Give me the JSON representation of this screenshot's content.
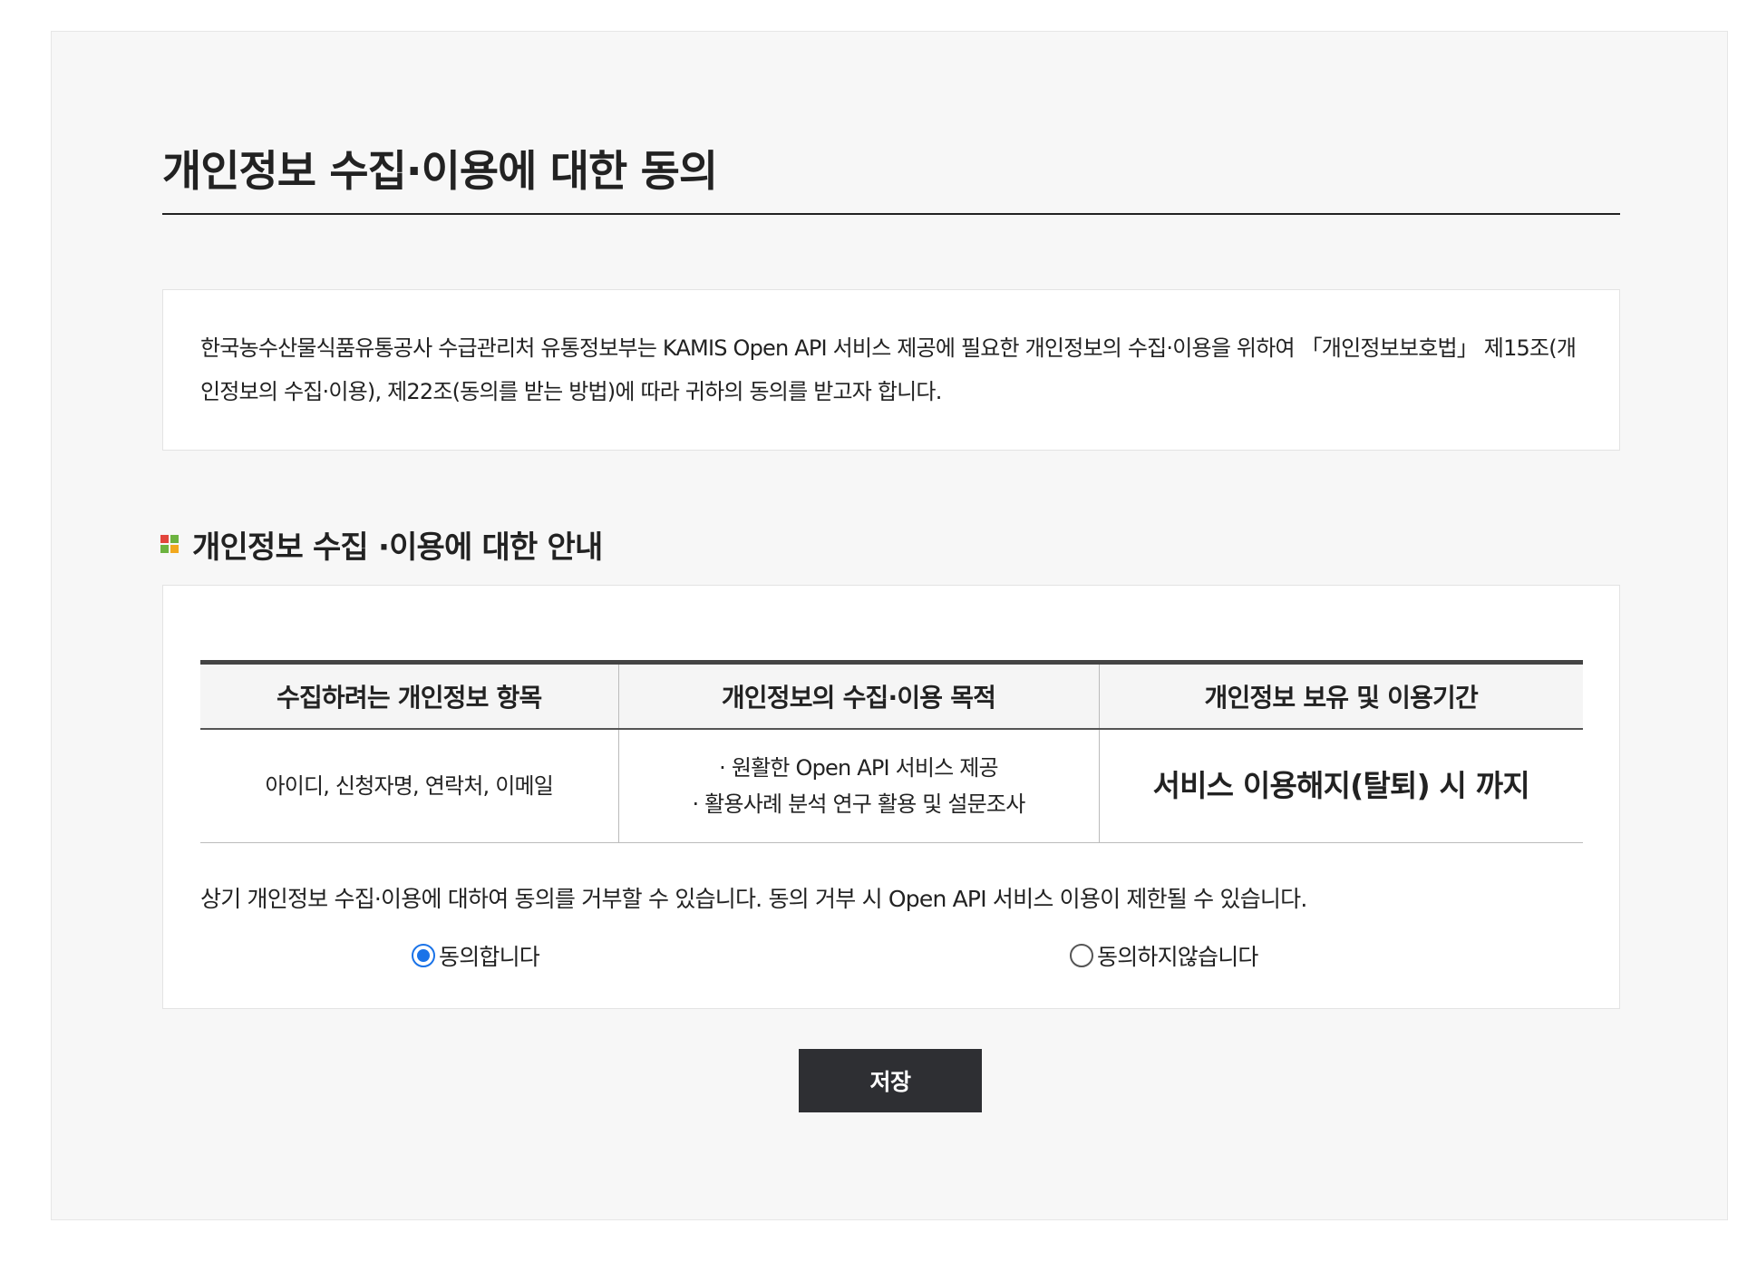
{
  "page": {
    "title": "개인정보 수집·이용에 대한 동의"
  },
  "notice": {
    "text": "한국농수산물식품유통공사 수급관리처 유통정보부는 KAMIS Open API 서비스 제공에 필요한 개인정보의 수집·이용을 위하여 「개인정보보호법」 제15조(개인정보의 수집·이용), 제22조(동의를 받는 방법)에 따라 귀하의 동의를 받고자 합니다."
  },
  "section": {
    "title": "개인정보 수집 ·이용에 대한 안내",
    "icon": "grid-icon",
    "icon_colors": [
      "#e2453c",
      "#6cb33f",
      "#6cb33f",
      "#f2a81d"
    ]
  },
  "table": {
    "headers": [
      "수집하려는 개인정보 항목",
      "개인정보의 수집·이용 목적",
      "개인정보 보유 및 이용기간"
    ],
    "row": {
      "items": "아이디, 신청자명, 연락처, 이메일",
      "purposes": [
        "· 원활한 Open API 서비스 제공",
        "· 활용사례 분석 연구 활용 및 설문조사"
      ],
      "period": "서비스 이용해지(탈퇴) 시 까지"
    }
  },
  "consent": {
    "note": "상기 개인정보 수집·이용에 대하여 동의를 거부할 수 있습니다. 동의 거부 시 Open API 서비스 이용이 제한될 수 있습니다.",
    "options": [
      {
        "label": "동의합니다",
        "selected": true
      },
      {
        "label": "동의하지않습니다",
        "selected": false
      }
    ]
  },
  "actions": {
    "save_label": "저장"
  },
  "colors": {
    "button_bg": "#2e2f33",
    "radio_selected": "#1a73e8",
    "panel_bg": "#f7f7f7"
  }
}
